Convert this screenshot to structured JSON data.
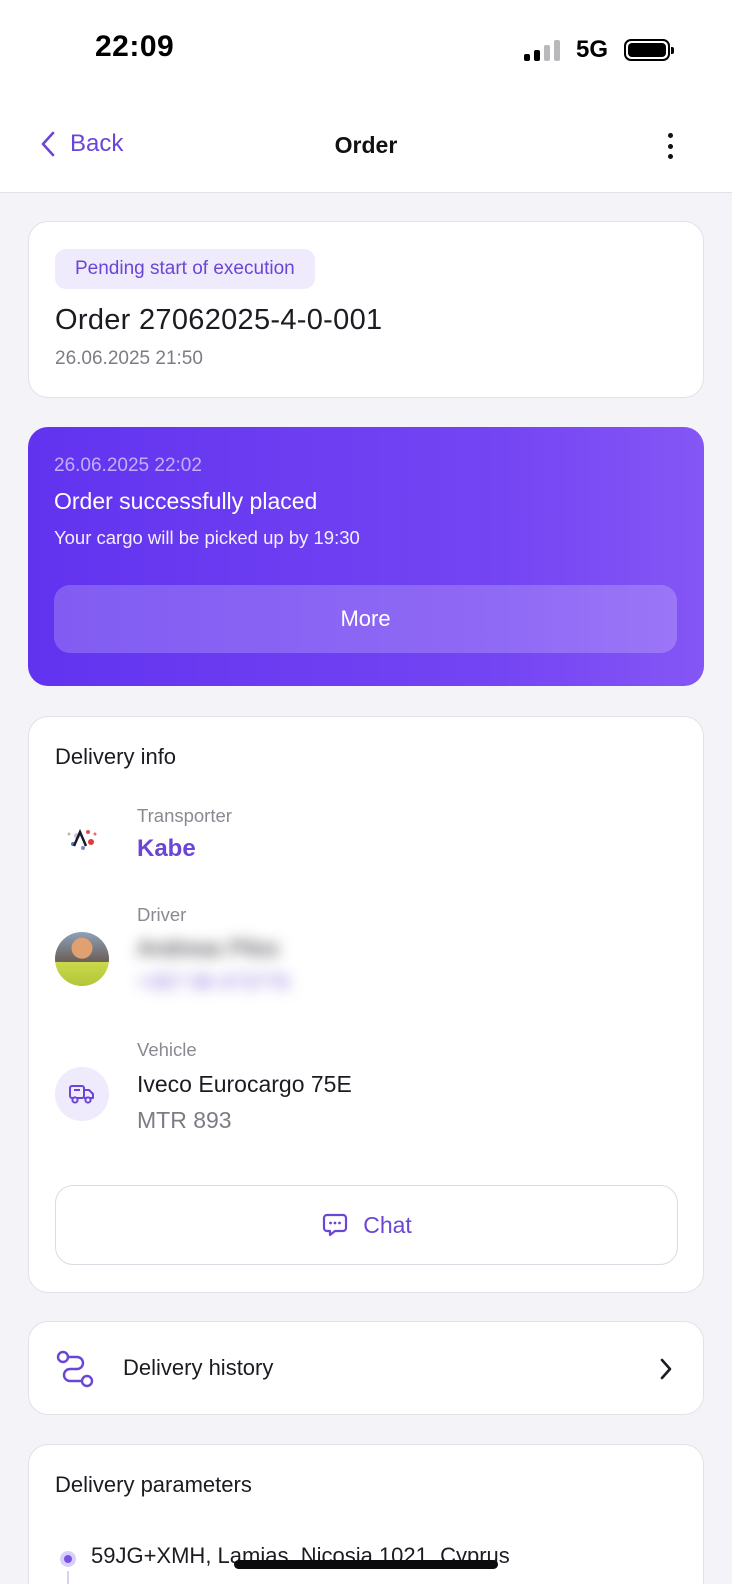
{
  "status_bar": {
    "time": "22:09",
    "network": "5G"
  },
  "nav": {
    "back_label": "Back",
    "title": "Order"
  },
  "order": {
    "status": "Pending start of execution",
    "number": "Order 27062025-4-0-001",
    "created": "26.06.2025 21:50"
  },
  "notification": {
    "date": "26.06.2025 22:02",
    "title": "Order successfully placed",
    "subtitle": "Your cargo will be picked up by 19:30",
    "button_label": "More"
  },
  "delivery_info": {
    "title": "Delivery info",
    "transporter_label": "Transporter",
    "transporter_name": "Kabe",
    "driver_label": "Driver",
    "driver_name": "Andreas Pilos",
    "driver_phone": "+357 99 473776",
    "vehicle_label": "Vehicle",
    "vehicle_model": "Iveco Eurocargo 75E",
    "vehicle_plate": "MTR 893",
    "chat_label": "Chat"
  },
  "history": {
    "label": "Delivery history"
  },
  "parameters": {
    "title": "Delivery parameters",
    "address": "59JG+XMH, Lamias, Nicosia 1021, Cyprus"
  },
  "colors": {
    "accent": "#6b45d6",
    "promo": "#6a3cf0",
    "background": "#f4f3f8"
  }
}
